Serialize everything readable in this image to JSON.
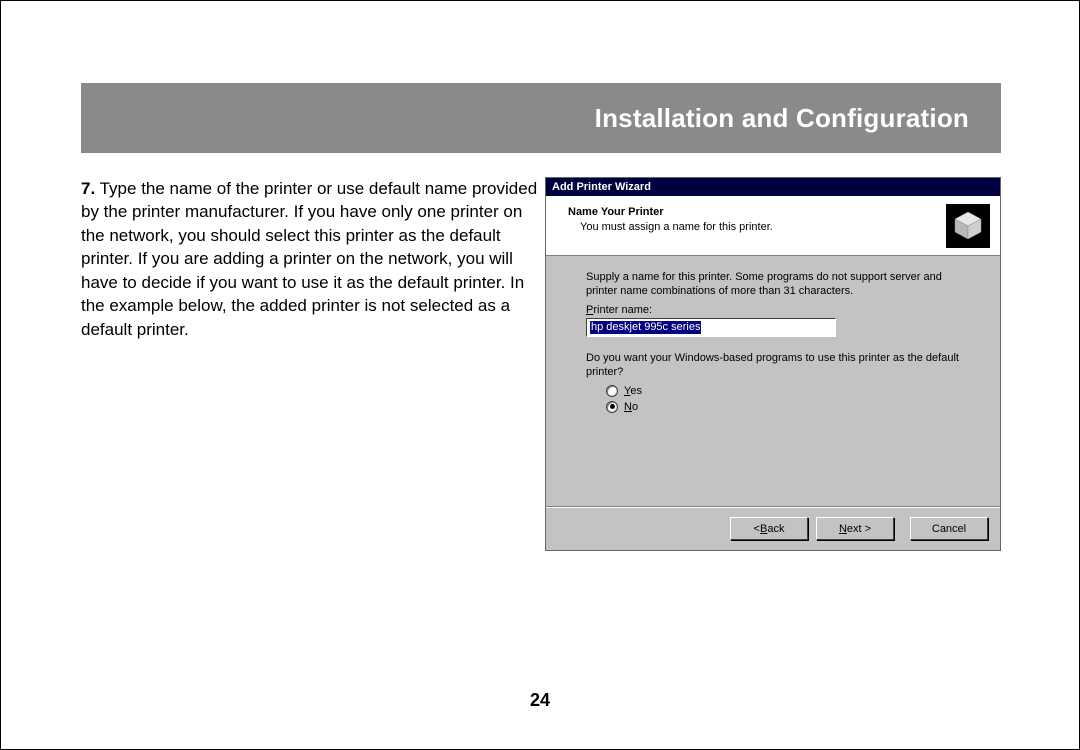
{
  "header": {
    "title": "Installation and Configuration"
  },
  "step": {
    "number": "7.",
    "text": "Type the name of the printer or use default name provided by the printer manufacturer. If you have only one printer on the network, you should select this printer as the default printer. If you are adding a printer on the network, you will have to decide if you want to use it as the default printer. In the example below, the added printer is not selected as a default printer."
  },
  "dialog": {
    "title": "Add Printer Wizard",
    "heading": "Name Your Printer",
    "subheading": "You must assign a name for this printer.",
    "supply_text": "Supply a name for this printer. Some programs do not support server and printer name combinations of more than 31 characters.",
    "printer_name_label_pre": "P",
    "printer_name_label_rest": "rinter name:",
    "printer_name_value": "hp deskjet 995c series",
    "default_question": "Do you want your Windows-based programs to use this printer as the default printer?",
    "yes_pre": "Y",
    "yes_rest": "es",
    "no_pre": "N",
    "no_rest": "o",
    "buttons": {
      "back_pre": "< ",
      "back_ul": "B",
      "back_rest": "ack",
      "next_pre": "",
      "next_ul": "N",
      "next_rest": "ext >",
      "cancel": "Cancel"
    }
  },
  "page_number": "24"
}
